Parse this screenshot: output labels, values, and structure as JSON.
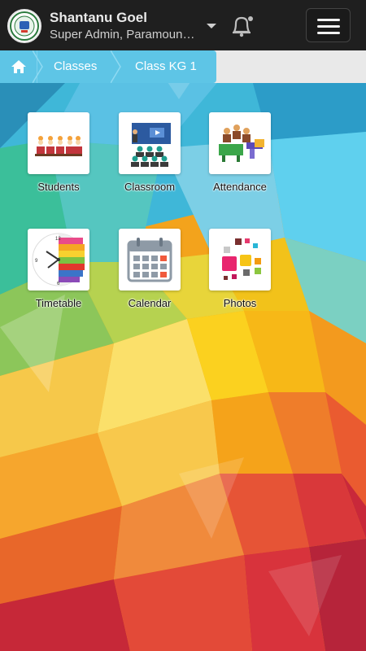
{
  "header": {
    "user_name": "Shantanu Goel",
    "user_role": "Super Admin, Paramount Public School",
    "icons": {
      "logo": "school-logo",
      "dropdown": "chevron-down-icon",
      "notifications": "bell-icon",
      "menu": "hamburger-menu-icon"
    }
  },
  "breadcrumb": {
    "home_icon": "home-icon",
    "items": [
      "Classes",
      "Class KG 1"
    ]
  },
  "tiles": [
    {
      "label": "Students",
      "icon": "students-icon"
    },
    {
      "label": "Classroom",
      "icon": "classroom-icon"
    },
    {
      "label": "Attendance",
      "icon": "attendance-icon"
    },
    {
      "label": "Timetable",
      "icon": "timetable-icon"
    },
    {
      "label": "Calendar",
      "icon": "calendar-icon"
    },
    {
      "label": "Photos",
      "icon": "photos-icon"
    }
  ],
  "colors": {
    "header_bg": "#1f1f1f",
    "breadcrumb_accent": "#5ec5e6"
  }
}
